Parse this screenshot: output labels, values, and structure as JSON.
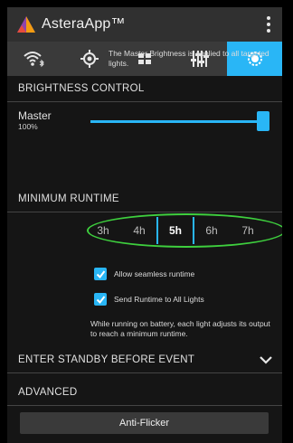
{
  "app": {
    "title": "AsteraApp™"
  },
  "tabs": [
    {
      "icon": "wifi-bluetooth-icon",
      "active": false
    },
    {
      "icon": "target-icon",
      "active": false
    },
    {
      "icon": "grid-icon",
      "active": false
    },
    {
      "icon": "mixer-sliders-icon",
      "active": false
    },
    {
      "icon": "brightness-icon",
      "active": true
    }
  ],
  "brightness": {
    "header": "BRIGHTNESS CONTROL",
    "master_label": "Master",
    "master_value": "100%",
    "level": 1.0,
    "note": "The Master Brightness is applied to all targeted lights."
  },
  "runtime": {
    "header": "MINIMUM RUNTIME",
    "options": [
      "3h",
      "4h",
      "5h",
      "6h",
      "7h"
    ],
    "selected": "5h",
    "allow_seamless_label": "Allow seamless runtime",
    "allow_seamless_checked": true,
    "send_runtime_label": "Send Runtime to All Lights",
    "send_runtime_checked": true,
    "note": "While running on battery, each light adjusts its output to reach a minimum runtime."
  },
  "standby": {
    "header": "ENTER STANDBY BEFORE EVENT"
  },
  "advanced": {
    "header": "ADVANCED",
    "anti_flicker_label": "Anti-Flicker"
  },
  "colors": {
    "accent": "#29b6f6",
    "highlight_ellipse": "#3ecf3e",
    "appbar": "#303030",
    "background": "#151515"
  }
}
